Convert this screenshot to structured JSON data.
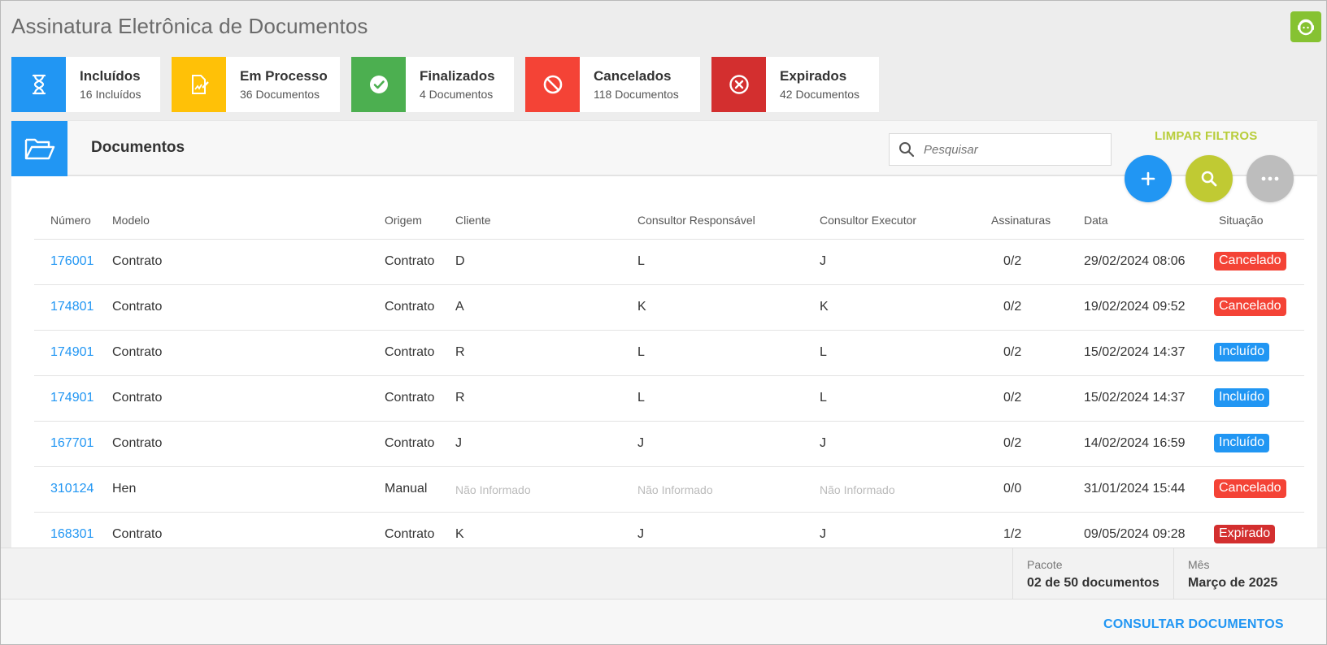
{
  "app": {
    "title": "Assinatura Eletrônica de Documentos",
    "support_icon": "support-agent-icon"
  },
  "stats": [
    {
      "label": "Incluídos",
      "sub": "16 Incluídos",
      "color": "#2196f3",
      "icon": "hourglass-icon"
    },
    {
      "label": "Em Processo",
      "sub": "36 Documentos",
      "color": "#ffc107",
      "icon": "document-sign-icon"
    },
    {
      "label": "Finalizados",
      "sub": "4 Documentos",
      "color": "#4caf50",
      "icon": "check-circle-icon"
    },
    {
      "label": "Cancelados",
      "sub": "118 Documentos",
      "color": "#f44336",
      "icon": "block-icon"
    },
    {
      "label": "Expirados",
      "sub": "42 Documentos",
      "color": "#d32f2f",
      "icon": "x-circle-icon"
    }
  ],
  "panel": {
    "title": "Documentos",
    "search_placeholder": "Pesquisar",
    "clear_filters": "LIMPAR FILTROS"
  },
  "table": {
    "columns": [
      "Número",
      "Modelo",
      "Origem",
      "Cliente",
      "Consultor Responsável",
      "Consultor Executor",
      "Assinaturas",
      "Data",
      "Situação"
    ],
    "rows": [
      {
        "numero": "176001",
        "modelo": "Contrato",
        "origem": "Contrato",
        "cliente": "D",
        "responsavel": "L",
        "executor": "J",
        "assinaturas": "0/2",
        "data": "29/02/2024 08:06",
        "situacao": "Cancelado"
      },
      {
        "numero": "174801",
        "modelo": "Contrato",
        "origem": "Contrato",
        "cliente": "A",
        "responsavel": "K",
        "executor": "K",
        "assinaturas": "0/2",
        "data": "19/02/2024 09:52",
        "situacao": "Cancelado"
      },
      {
        "numero": "174901",
        "modelo": "Contrato",
        "origem": "Contrato",
        "cliente": "R",
        "responsavel": "L",
        "executor": "L",
        "assinaturas": "0/2",
        "data": "15/02/2024 14:37",
        "situacao": "Incluído"
      },
      {
        "numero": "174901",
        "modelo": "Contrato",
        "origem": "Contrato",
        "cliente": "R",
        "responsavel": "L",
        "executor": "L",
        "assinaturas": "0/2",
        "data": "15/02/2024 14:37",
        "situacao": "Incluído"
      },
      {
        "numero": "167701",
        "modelo": "Contrato",
        "origem": "Contrato",
        "cliente": "J",
        "responsavel": "J",
        "executor": "J",
        "assinaturas": "0/2",
        "data": "14/02/2024 16:59",
        "situacao": "Incluído"
      },
      {
        "numero": "310124",
        "modelo": "Hen",
        "origem": "Manual",
        "cliente": "Não Informado",
        "responsavel": "Não Informado",
        "executor": "Não Informado",
        "assinaturas": "0/0",
        "data": "31/01/2024 15:44",
        "situacao": "Cancelado"
      },
      {
        "numero": "168301",
        "modelo": "Contrato",
        "origem": "Contrato",
        "cliente": "K",
        "responsavel": "J",
        "executor": "J",
        "assinaturas": "1/2",
        "data": "09/05/2024 09:28",
        "situacao": "Expirado"
      }
    ]
  },
  "status_colors": {
    "Cancelado": "#f44336",
    "Incluído": "#2196f3",
    "Expirado": "#d32f2f"
  },
  "footer": {
    "pacote_label": "Pacote",
    "pacote_value": "02 de 50 documentos",
    "mes_label": "Mês",
    "mes_value": "Março de 2025",
    "consult_button": "CONSULTAR DOCUMENTOS"
  }
}
